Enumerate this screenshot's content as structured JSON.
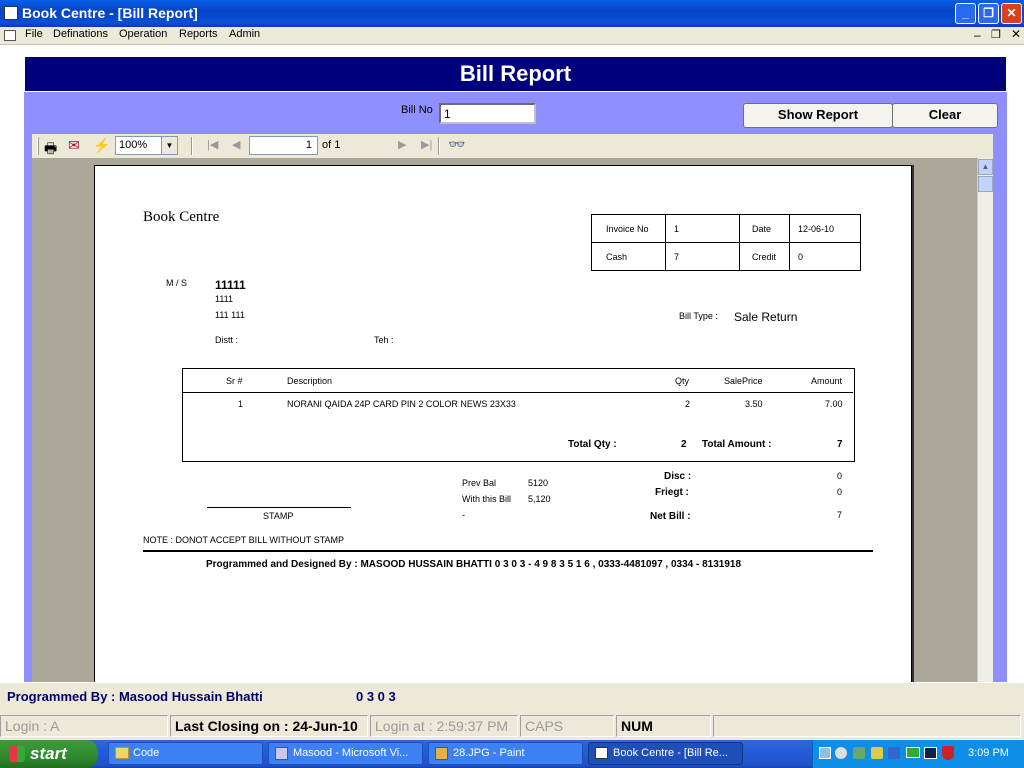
{
  "window": {
    "title": "Book Centre  - [Bill Report]"
  },
  "menu": [
    "File",
    "Definations",
    "Operation",
    "Reports",
    "Admin"
  ],
  "form": {
    "heading": "Bill Report",
    "bill_no_label": "Bill No",
    "bill_no_value": "1",
    "show_report_label": "Show Report",
    "clear_label": "Clear"
  },
  "viewer": {
    "zoom": "100%",
    "page_value": "1",
    "page_of": "of 1"
  },
  "report": {
    "company": "Book Centre",
    "invoice_no_label": "Invoice No",
    "invoice_no": "1",
    "date_label": "Date",
    "date": "12-06-10",
    "cash_label": "Cash",
    "cash": "7",
    "credit_label": "Credit",
    "credit": "0",
    "ms_label": "M / S",
    "customer_name": "11111",
    "customer_line1": "1111",
    "customer_line2": "111  111",
    "bill_type_label": "Bill Type :",
    "bill_type": "Sale Return",
    "distt_label": "Distt :",
    "teh_label": "Teh :",
    "columns": {
      "sr": "Sr #",
      "description": "Description",
      "qty": "Qty",
      "saleprice": "SalePrice",
      "amount": "Amount"
    },
    "rows": [
      {
        "sr": "1",
        "description": "NORANI QAIDA 24P CARD PIN 2 COLOR NEWS 23X33",
        "qty": "2",
        "saleprice": "3.50",
        "amount": "7.00"
      }
    ],
    "total_qty_label": "Total Qty :",
    "total_qty": "2",
    "total_amount_label": "Total Amount :",
    "total_amount": "7",
    "prev_bal_label": "Prev Bal",
    "prev_bal": "5120",
    "with_bill_label": "With this Bill",
    "with_bill": "5,120",
    "dash": "-",
    "disc_label": "Disc :",
    "disc": "0",
    "friegt_label": "Friegt :",
    "friegt": "0",
    "net_bill_label": "Net Bill :",
    "net_bill": "7",
    "stamp_label": "STAMP",
    "note": "NOTE : DONOT ACCEPT BILL WITHOUT STAMP",
    "programmer_line": "Programmed and Designed By : MASOOD HUSSAIN BHATTI  0 3 0 3 - 4 9 8 3 5 1 6  ,  0333-4481097 , 0334 - 8131918"
  },
  "status": {
    "programmed_by": "Programmed By : Masood Hussain Bhatti",
    "code": "0 3 0 3",
    "login": "Login :  A",
    "last_closing": "Last Closing on : 24-Jun-10",
    "login_at": "Login at : 2:59:37 PM",
    "caps": "CAPS",
    "num": "NUM"
  },
  "taskbar": {
    "start": "start",
    "tasks": [
      "Code",
      "Masood - Microsoft Vi...",
      "28.JPG - Paint",
      "Book Centre  - [Bill Re..."
    ],
    "clock": "3:09 PM"
  }
}
